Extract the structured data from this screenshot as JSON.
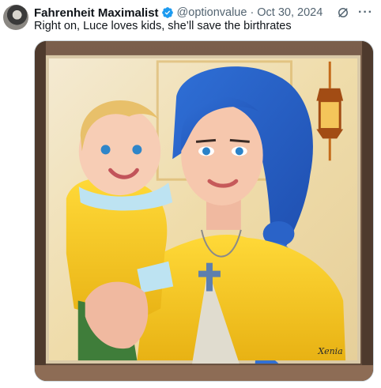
{
  "tweet": {
    "author_name": "Fahrenheit Maximalist",
    "handle": "@optionvalue",
    "separator": "·",
    "date": "Oct 30, 2024",
    "more_label": "···",
    "text": "Right on, Luce loves kids, she’ll save the birthrates",
    "verified_color": "#1d9bf0"
  },
  "media": {
    "signature": "Xenia"
  },
  "icons": {
    "avatar": "avatar",
    "verified": "verified-badge-icon",
    "grok": "grok-icon",
    "more": "more-icon"
  }
}
